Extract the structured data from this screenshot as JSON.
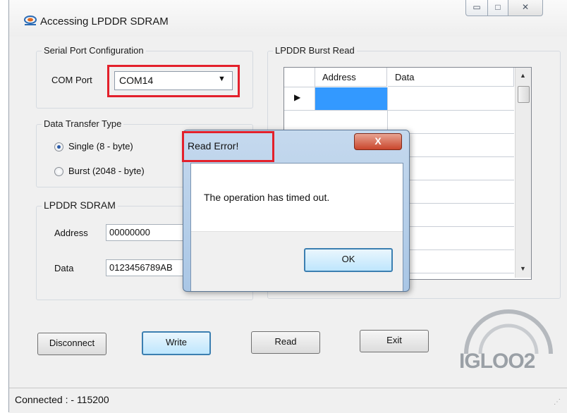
{
  "window": {
    "title": "Accessing LPDDR SDRAM",
    "controls": [
      "▭",
      "□",
      "✕"
    ]
  },
  "serial": {
    "group_label": "Serial Port Configuration",
    "com_label": "COM Port",
    "com_value": "COM14"
  },
  "transfer": {
    "group_label": "Data Transfer Type",
    "single": "Single (8 - byte)",
    "burst": "Burst (2048 - byte)"
  },
  "sdram": {
    "group_label": "LPDDR SDRAM",
    "address_label": "Address",
    "address_value": "00000000",
    "data_label": "Data",
    "data_value": "0123456789AB"
  },
  "burst_read": {
    "group_label": "LPDDR Burst Read",
    "col_address": "Address",
    "col_data": "Data"
  },
  "buttons": {
    "disconnect": "Disconnect",
    "write": "Write",
    "read": "Read",
    "exit": "Exit"
  },
  "logo": {
    "text": "IGLOO2"
  },
  "status": {
    "text": "Connected : - 115200"
  },
  "dialog": {
    "title": "Read Error!",
    "message": "The operation has timed out.",
    "ok": "OK",
    "close": "X"
  },
  "colors": {
    "highlight_red": "#e3202b",
    "selected_cell": "#3399ff",
    "logo_gray": "#9aa0a6",
    "logo_orange": "#f26b1d"
  }
}
